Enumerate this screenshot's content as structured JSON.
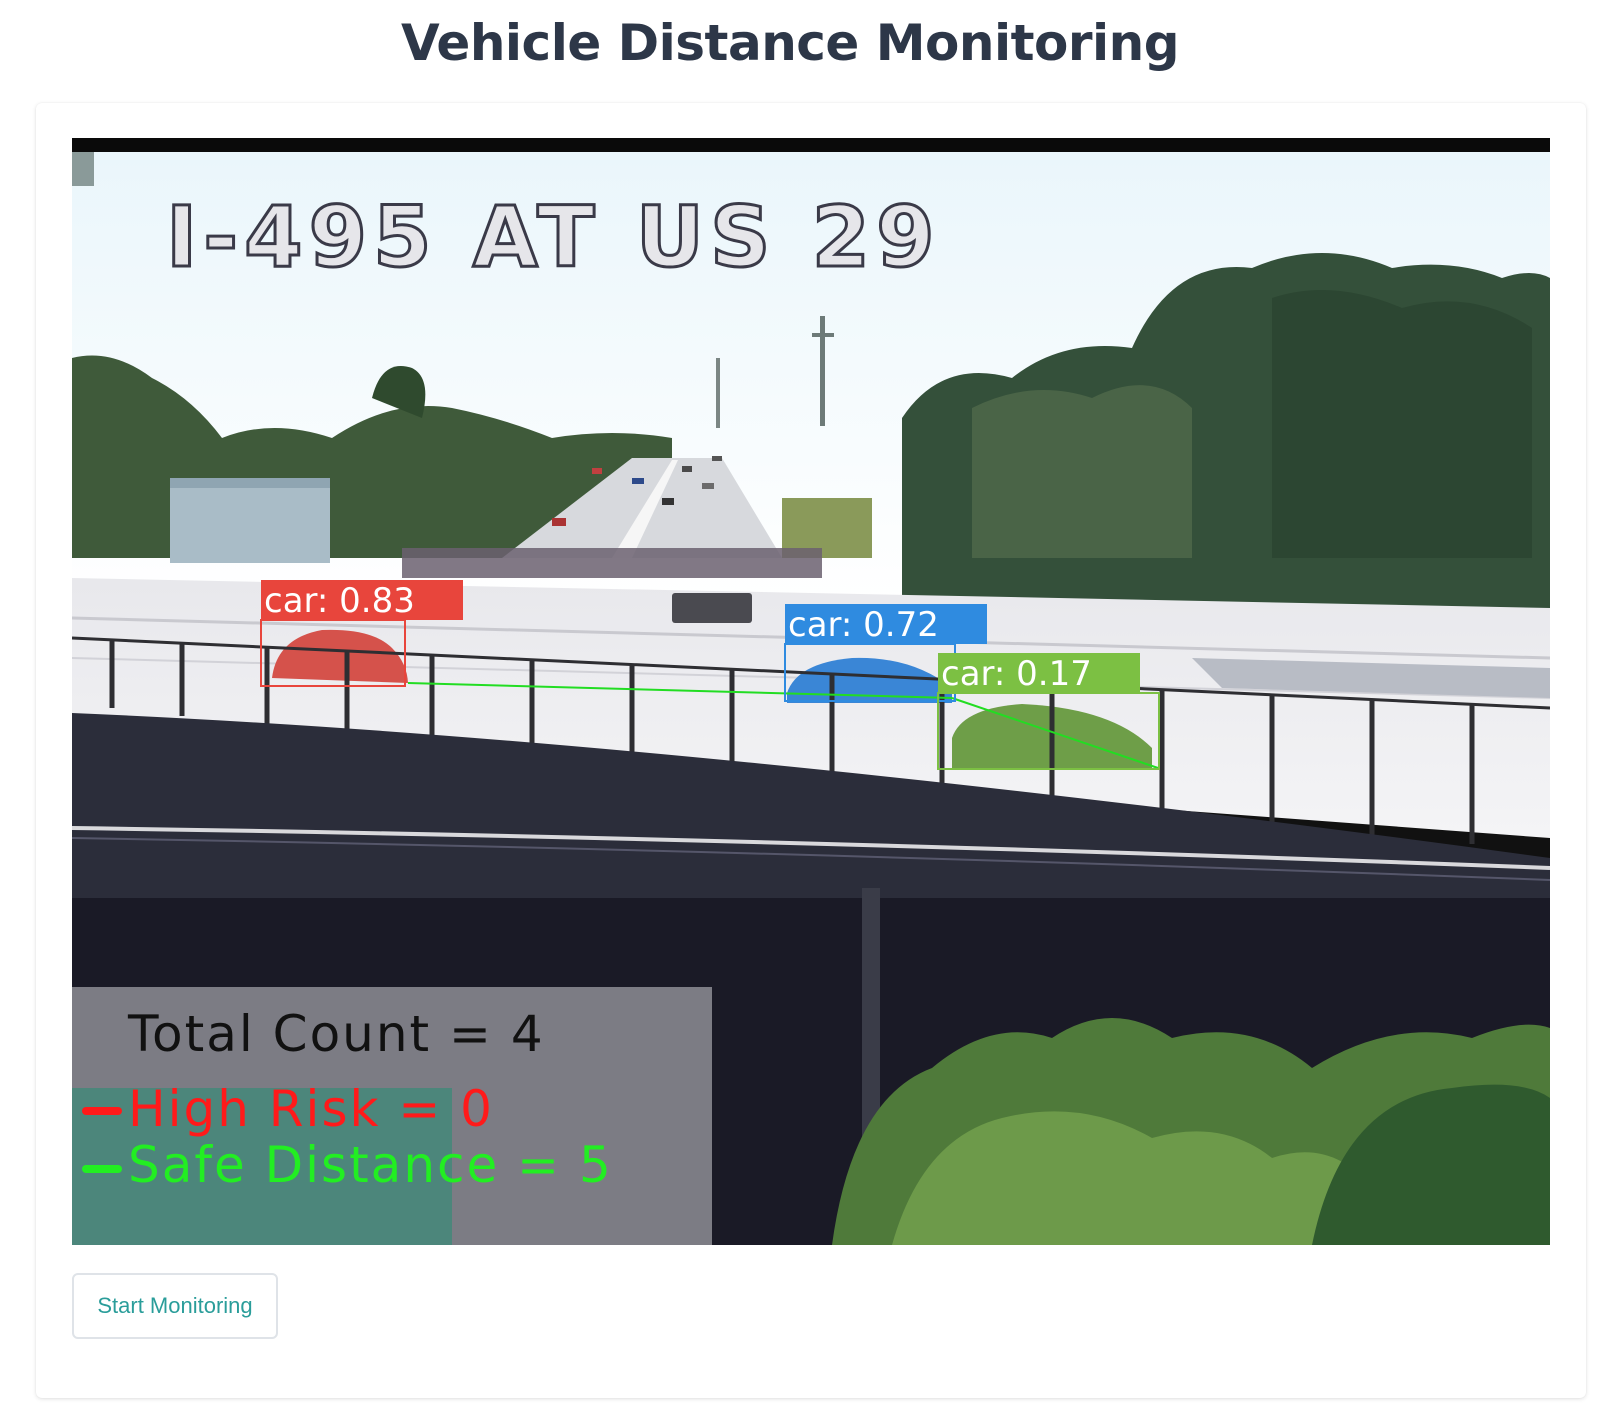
{
  "page": {
    "title": "Vehicle Distance Monitoring"
  },
  "feed": {
    "camera_label": "I-495 AT US 29",
    "detections": [
      {
        "label": "car: 0.83",
        "class": "car",
        "confidence": 0.83,
        "color": "#e8453c"
      },
      {
        "label": "car: 0.72",
        "class": "car",
        "confidence": 0.72,
        "color": "#2f8be0"
      },
      {
        "label": "car: 0.17",
        "class": "car",
        "confidence": 0.17,
        "color": "#7cc043"
      }
    ],
    "stats": {
      "total_count": "Total Count = 4",
      "high_risk": "High Risk = 0",
      "safe_distance": "Safe Distance = 5"
    },
    "colors": {
      "high_risk": "#ff1a1a",
      "safe_distance": "#22ee22",
      "distance_line": "#22dd22"
    }
  },
  "controls": {
    "start_label": "Start Monitoring"
  }
}
